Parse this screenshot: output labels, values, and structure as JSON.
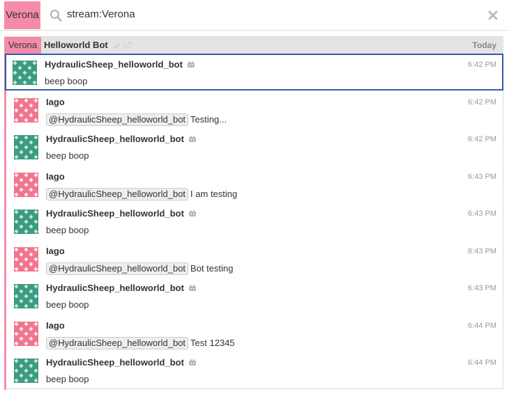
{
  "search": {
    "stream_label": "Verona",
    "query": "stream:Verona"
  },
  "recipient": {
    "stream": "Verona",
    "topic": "Helloworld Bot",
    "date": "Today"
  },
  "colors": {
    "stream": "#f48ca9",
    "selected_border": "#2e5cb0",
    "bot_avatar": "#3b9b80",
    "human_avatar": "#f0768f"
  },
  "messages": [
    {
      "sender": "HydraulicSheep_helloworld_bot",
      "is_bot": true,
      "time": "6:42 PM",
      "mention": "",
      "text": "beep boop",
      "selected": true
    },
    {
      "sender": "Iago",
      "is_bot": false,
      "time": "6:42 PM",
      "mention": "@HydraulicSheep_helloworld_bot",
      "text": "Testing...",
      "selected": false
    },
    {
      "sender": "HydraulicSheep_helloworld_bot",
      "is_bot": true,
      "time": "6:42 PM",
      "mention": "",
      "text": "beep boop",
      "selected": false
    },
    {
      "sender": "Iago",
      "is_bot": false,
      "time": "6:43 PM",
      "mention": "@HydraulicSheep_helloworld_bot",
      "text": "I am testing",
      "selected": false
    },
    {
      "sender": "HydraulicSheep_helloworld_bot",
      "is_bot": true,
      "time": "6:43 PM",
      "mention": "",
      "text": "beep boop",
      "selected": false
    },
    {
      "sender": "Iago",
      "is_bot": false,
      "time": "6:43 PM",
      "mention": "@HydraulicSheep_helloworld_bot",
      "text": "Bot testing",
      "selected": false
    },
    {
      "sender": "HydraulicSheep_helloworld_bot",
      "is_bot": true,
      "time": "6:43 PM",
      "mention": "",
      "text": "beep boop",
      "selected": false
    },
    {
      "sender": "Iago",
      "is_bot": false,
      "time": "6:44 PM",
      "mention": "@HydraulicSheep_helloworld_bot",
      "text": "Test 12345",
      "selected": false
    },
    {
      "sender": "HydraulicSheep_helloworld_bot",
      "is_bot": true,
      "time": "6:44 PM",
      "mention": "",
      "text": "beep boop",
      "selected": false
    }
  ]
}
